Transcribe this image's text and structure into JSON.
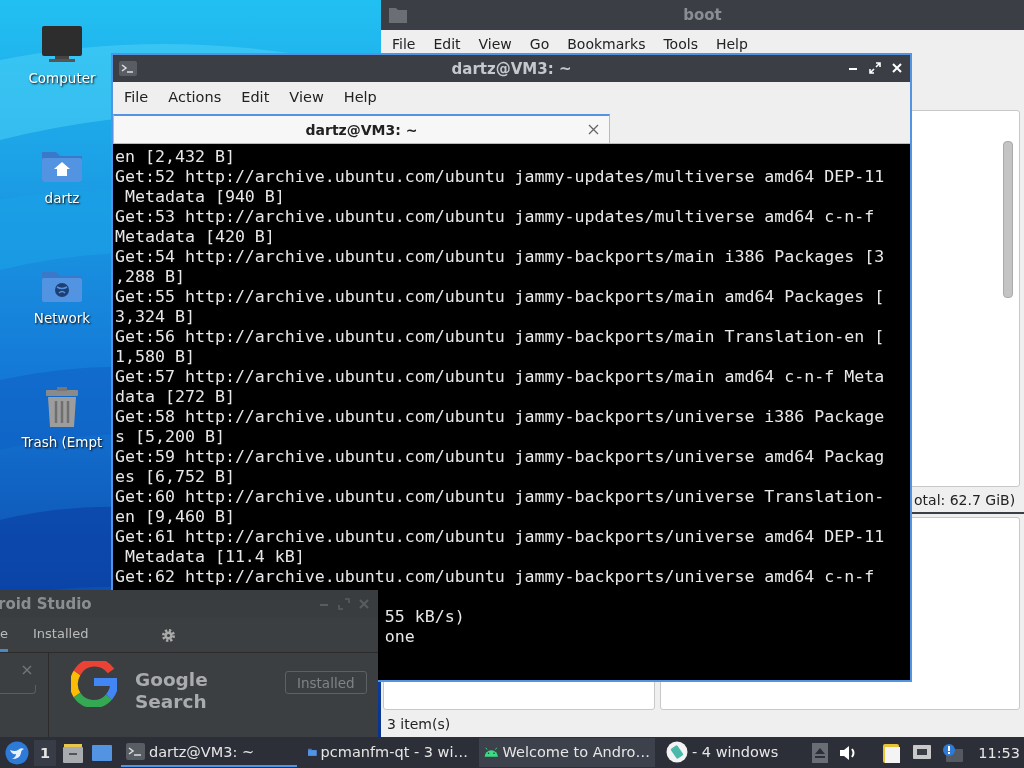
{
  "desktop_icons": [
    {
      "label": "Computer",
      "kind": "computer"
    },
    {
      "label": "dartz",
      "kind": "home"
    },
    {
      "label": "Network",
      "kind": "network"
    },
    {
      "label": "Trash (Empt",
      "kind": "trash"
    }
  ],
  "file_manager": {
    "title": "boot",
    "menu": [
      "File",
      "Edit",
      "View",
      "Go",
      "Bookmarks",
      "Tools",
      "Help"
    ],
    "status_total": "otal: 62.7 GiB)",
    "status_items": "3 item(s)"
  },
  "terminal": {
    "title": "dartz@VM3: ~",
    "menu": [
      "File",
      "Actions",
      "Edit",
      "View",
      "Help"
    ],
    "tabs": [
      {
        "label": "dartz@VM3: ~",
        "selected": true
      }
    ],
    "lines": [
      "en [2,432 B]",
      "Get:52 http://archive.ubuntu.com/ubuntu jammy-updates/multiverse amd64 DEP-11",
      " Metadata [940 B]",
      "Get:53 http://archive.ubuntu.com/ubuntu jammy-updates/multiverse amd64 c-n-f",
      "Metadata [420 B]",
      "Get:54 http://archive.ubuntu.com/ubuntu jammy-backports/main i386 Packages [3",
      ",288 B]",
      "Get:55 http://archive.ubuntu.com/ubuntu jammy-backports/main amd64 Packages [",
      "3,324 B]",
      "Get:56 http://archive.ubuntu.com/ubuntu jammy-backports/main Translation-en [",
      "1,580 B]",
      "Get:57 http://archive.ubuntu.com/ubuntu jammy-backports/main amd64 c-n-f Meta",
      "data [272 B]",
      "Get:58 http://archive.ubuntu.com/ubuntu jammy-backports/universe i386 Package",
      "s [5,200 B]",
      "Get:59 http://archive.ubuntu.com/ubuntu jammy-backports/universe amd64 Packag",
      "es [6,752 B]",
      "Get:60 http://archive.ubuntu.com/ubuntu jammy-backports/universe Translation-",
      "en [9,460 B]",
      "Get:61 http://archive.ubuntu.com/ubuntu jammy-backports/universe amd64 DEP-11",
      " Metadata [11.4 kB]",
      "Get:62 http://archive.ubuntu.com/ubuntu jammy-backports/universe amd64 c-n-f"
    ],
    "tail_lines": [
      "55 kB/s)",
      "one"
    ]
  },
  "android_studio": {
    "title": "roid Studio",
    "tabs": [
      {
        "label": "e",
        "selected": true
      },
      {
        "label": "Installed",
        "selected": false
      }
    ],
    "plugin_name": "Google Search",
    "plugin_button": "Installed"
  },
  "taskbar": {
    "workspace": "1",
    "tasks": [
      {
        "label": "dartz@VM3: ~",
        "kind": "terminal",
        "selected": true,
        "hovered": false
      },
      {
        "label": "pcmanfm-qt - 3 wi…",
        "kind": "folder",
        "selected": false,
        "hovered": false
      },
      {
        "label": "Welcome to Andro…",
        "kind": "android",
        "selected": false,
        "hovered": true
      },
      {
        "label": "- 4 windows",
        "kind": "group",
        "selected": false,
        "hovered": false
      }
    ],
    "clock": "11:53"
  }
}
